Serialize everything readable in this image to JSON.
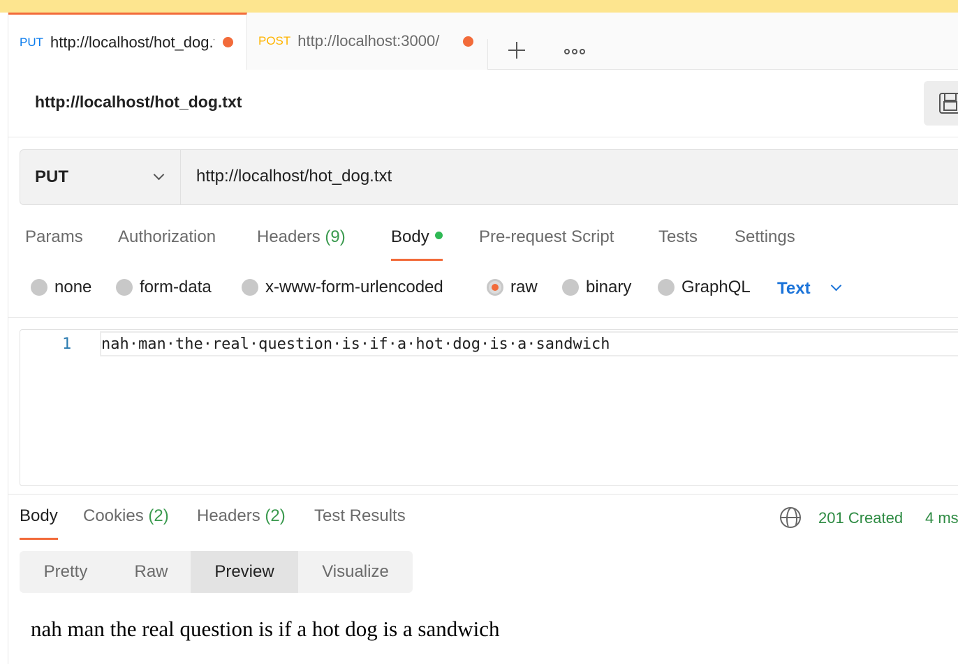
{
  "tabs": [
    {
      "method": "PUT",
      "url": "http://localhost/hot_dog.txt"
    },
    {
      "method": "POST",
      "url": "http://localhost:3000/"
    }
  ],
  "request": {
    "title": "http://localhost/hot_dog.txt",
    "method": "PUT",
    "url": "http://localhost/hot_dog.txt"
  },
  "request_tabs": {
    "params": "Params",
    "authorization": "Authorization",
    "headers": "Headers",
    "headers_count": "(9)",
    "body": "Body",
    "prerequest": "Pre-request Script",
    "tests": "Tests",
    "settings": "Settings"
  },
  "body_types": {
    "none": "none",
    "form_data": "form-data",
    "urlencoded": "x-www-form-urlencoded",
    "raw": "raw",
    "binary": "binary",
    "graphql": "GraphQL",
    "selected": "raw",
    "text_type": "Text"
  },
  "editor": {
    "line_number": "1",
    "content": "nah·man·the·real·question·is·if·a·hot·dog·is·a·sandwich"
  },
  "response_tabs": {
    "body": "Body",
    "cookies": "Cookies",
    "cookies_count": "(2)",
    "headers": "Headers",
    "headers_count": "(2)",
    "test_results": "Test Results"
  },
  "response": {
    "status": "201 Created",
    "time": "4 ms",
    "preview_text": "nah man the real question is if a hot dog is a sandwich"
  },
  "view_modes": {
    "pretty": "Pretty",
    "raw": "Raw",
    "preview": "Preview",
    "visualize": "Visualize",
    "selected": "Preview"
  },
  "colors": {
    "accent": "#f26b3a",
    "put": "#097bed",
    "post": "#ffb400",
    "status_ok": "#2e8b43",
    "link": "#1a73d9"
  }
}
